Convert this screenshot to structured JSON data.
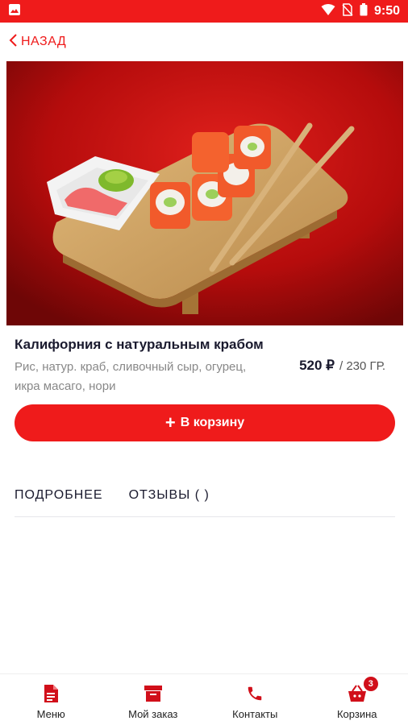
{
  "status_bar": {
    "time": "9:50"
  },
  "nav": {
    "back_label": "НАЗАД"
  },
  "product": {
    "title": "Калифорния с натуральным крабом",
    "description": "Рис, натур. краб, сливочный сыр, огурец, икра масаго, нори",
    "price": "520 ₽",
    "weight": "/ 230 ГР."
  },
  "actions": {
    "add_to_cart": "В корзину"
  },
  "tabs": [
    {
      "label": "ПОДРОБНЕЕ"
    },
    {
      "label": "ОТЗЫВЫ ( )"
    }
  ],
  "bottom_nav": [
    {
      "label": "Меню",
      "icon": "document-icon"
    },
    {
      "label": "Мой заказ",
      "icon": "archive-box-icon"
    },
    {
      "label": "Контакты",
      "icon": "phone-icon"
    },
    {
      "label": "Корзина",
      "icon": "basket-icon",
      "badge": "3"
    }
  ],
  "colors": {
    "accent": "#ef1b1b",
    "text": "#1a1a2e",
    "muted": "#888888"
  }
}
